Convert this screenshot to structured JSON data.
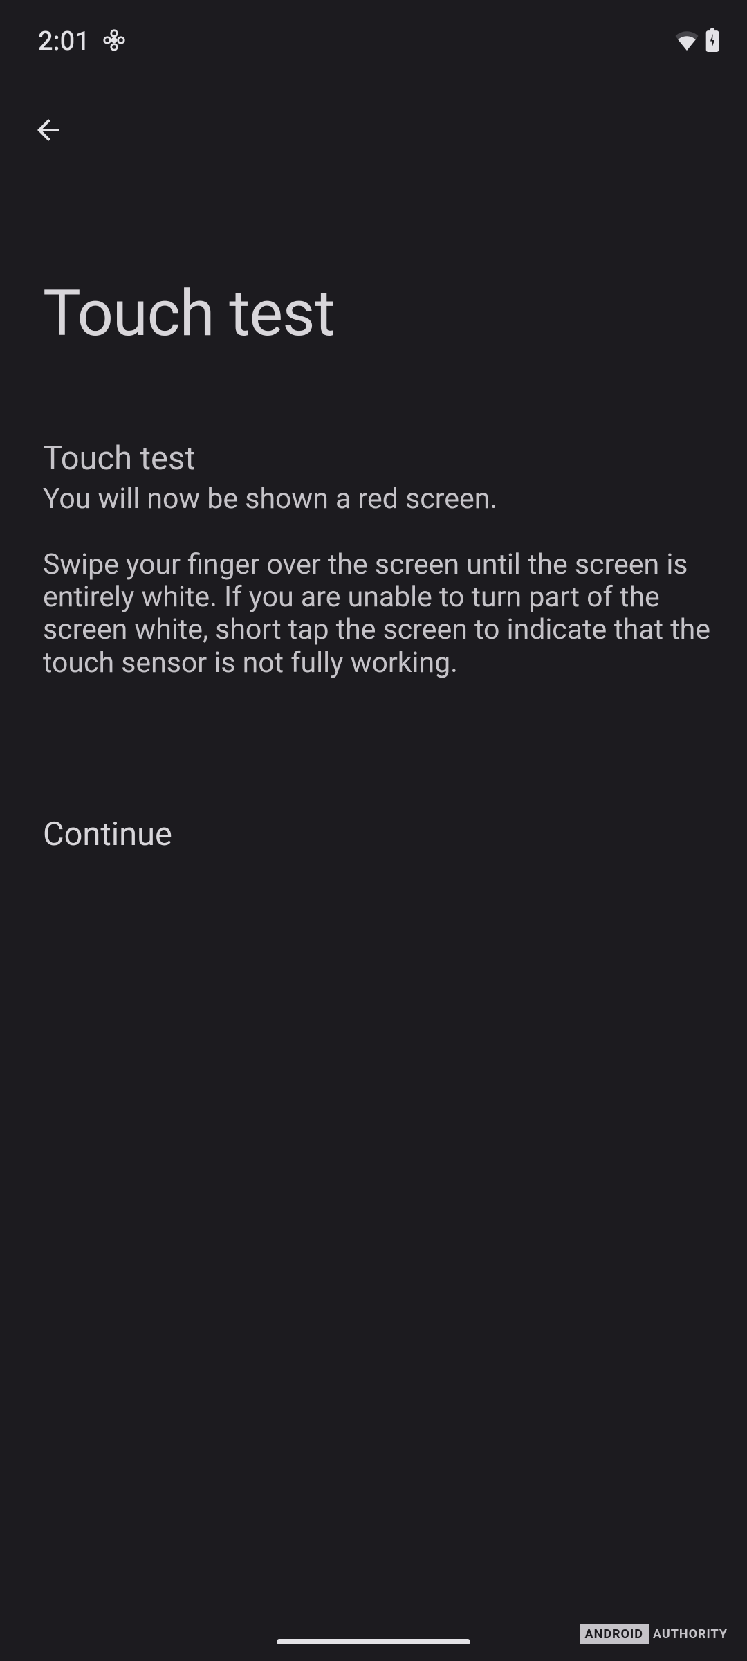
{
  "status_bar": {
    "time": "2:01"
  },
  "header": {
    "title": "Touch test"
  },
  "content": {
    "subtitle": "Touch test",
    "paragraph1": "You will now be shown a red screen.",
    "paragraph2": " Swipe your finger over the screen until the screen is entirely white. If you are unable to turn part of the screen white, short tap the screen to indicate that the touch sensor is not fully working."
  },
  "actions": {
    "continue_label": "Continue"
  },
  "watermark": {
    "part1": "ANDROID",
    "part2": "AUTHORITY"
  }
}
